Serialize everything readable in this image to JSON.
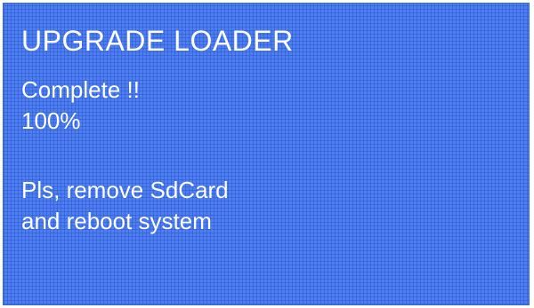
{
  "screen": {
    "title": "UPGRADE LOADER",
    "status": "Complete !!",
    "progress": "100%",
    "instruction_line1": "Pls, remove SdCard",
    "instruction_line2": "and reboot system"
  },
  "colors": {
    "background": "#4d7ff0",
    "text": "#ffffff"
  }
}
